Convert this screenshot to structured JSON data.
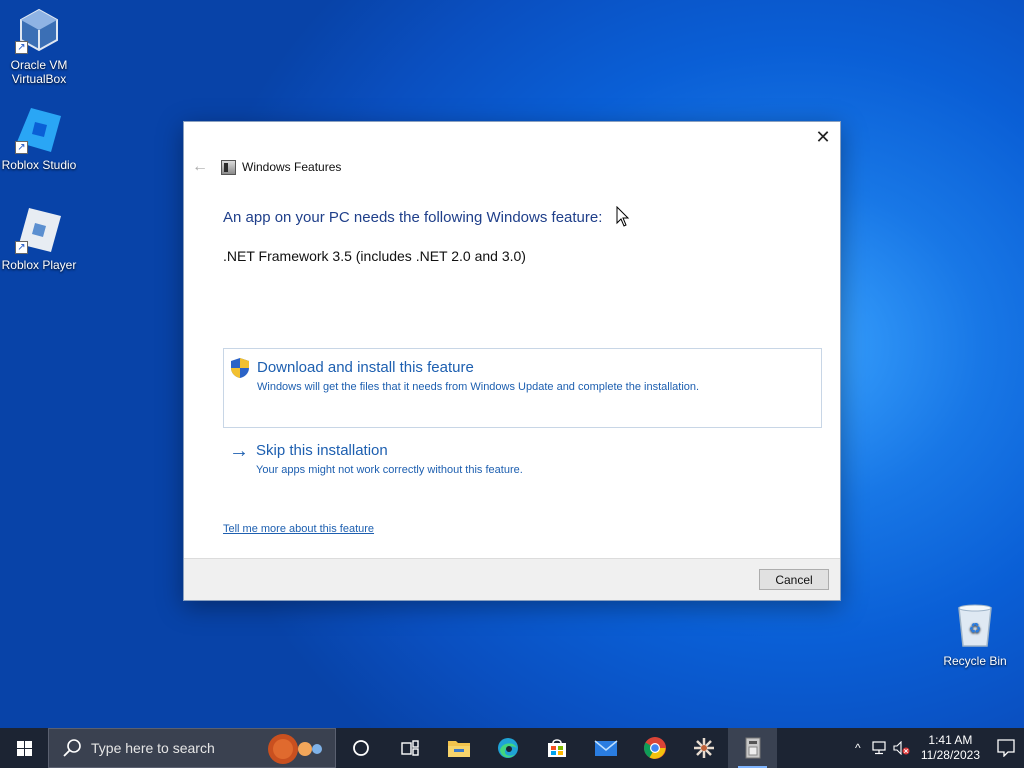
{
  "desktop": {
    "icons": [
      {
        "label": "Oracle VM VirtualBox"
      },
      {
        "label": "Roblox Studio"
      },
      {
        "label": "Roblox Player"
      },
      {
        "label": "Recycle Bin"
      }
    ]
  },
  "dialog": {
    "title": "Windows Features",
    "close_glyph": "✕",
    "back_glyph": "←",
    "heading": "An app on your PC needs the following Windows feature:",
    "feature": ".NET Framework 3.5 (includes .NET 2.0 and 3.0)",
    "download_option": {
      "title": "Download and install this feature",
      "subtitle": "Windows will get the files that it needs from Windows Update and complete the installation."
    },
    "skip_option": {
      "title": "Skip this installation",
      "subtitle": "Your apps might not work correctly without this feature.",
      "arrow": "→"
    },
    "link": "Tell me more about this feature",
    "cancel_label": "Cancel"
  },
  "taskbar": {
    "search_placeholder": "Type here to search",
    "apps": [
      "task-view",
      "file-explorer",
      "edge",
      "store",
      "mail",
      "chrome",
      "pinwheel-app",
      "windows-features"
    ],
    "tray": {
      "chevron": "^",
      "time": "1:41 AM",
      "date": "11/28/2023"
    }
  }
}
